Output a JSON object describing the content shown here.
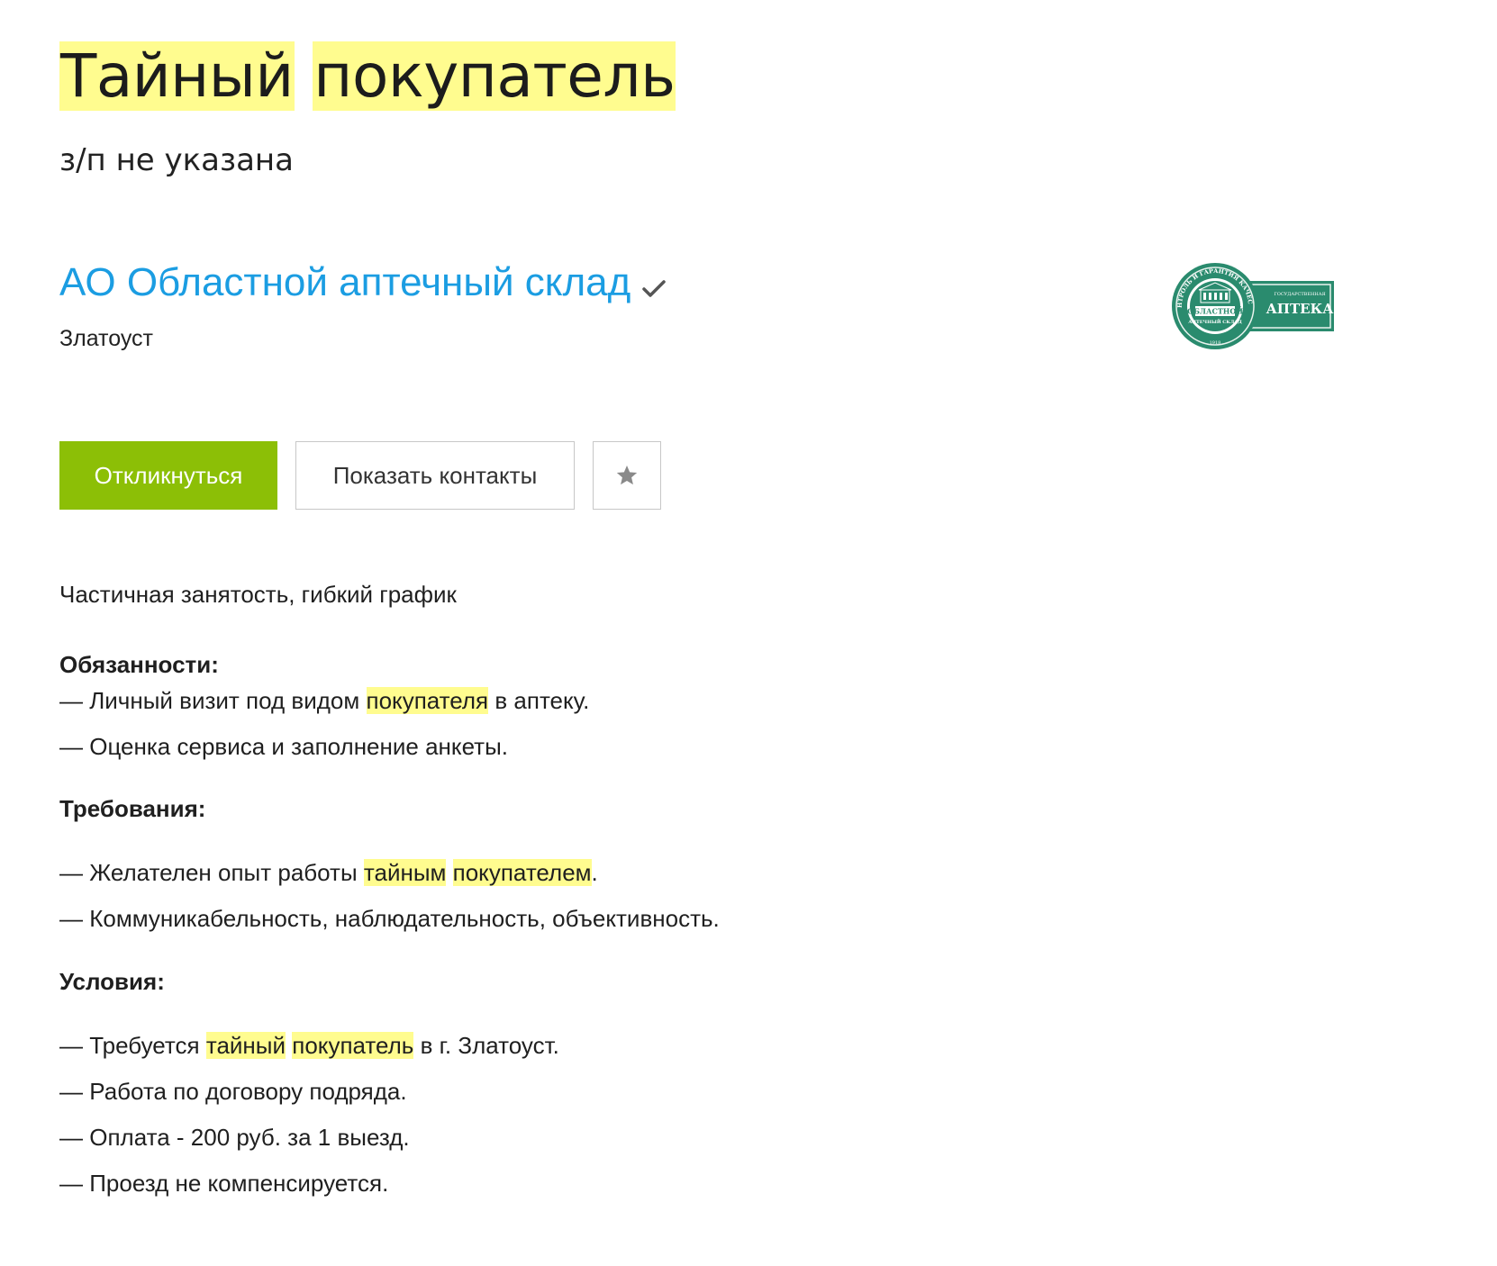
{
  "vacancy": {
    "title_word1": "Тайный",
    "title_word2": "покупатель",
    "salary": "з/п не указана"
  },
  "company": {
    "name": "АО Областной аптечный склад",
    "city": "Златоуст",
    "logo": {
      "ring_text_top": "КОНТРОЛЬ И ГАРАНТИЯ КАЧЕСТВА",
      "center_line1": "ОБЛАСТНОЙ",
      "center_line2": "АПТЕЧНЫЙ СКЛАД",
      "year": "1918",
      "right_small": "ГОСУДАРСТВЕННАЯ",
      "right_big": "АПТЕКА",
      "color": "#2a8b6e"
    }
  },
  "actions": {
    "respond_label": "Откликнуться",
    "contacts_label": "Показать контакты",
    "favorite_icon": "star-icon"
  },
  "description": {
    "employment": "Частичная занятость, гибкий график",
    "duties_heading": "Обязанности:",
    "duty1_pre": "— Личный визит под видом ",
    "duty1_hl": "покупателя",
    "duty1_post": " в аптеку.",
    "duty2": "— Оценка сервиса и заполнение анкеты.",
    "req_heading": "Требования:",
    "req1_pre": "— Желателен опыт работы ",
    "req1_hl1": "тайным",
    "req1_hl2": "покупателем",
    "req1_post": ".",
    "req2": "— Коммуникабельность, наблюдательность, объективность.",
    "cond_heading": "Условия:",
    "cond1_pre": "— Требуется ",
    "cond1_hl1": "тайный",
    "cond1_hl2": "покупатель",
    "cond1_post": " в г. Златоуст.",
    "cond2": "— Работа по договору подряда.",
    "cond3": "— Оплата - 200 руб. за 1 выезд.",
    "cond4": "— Проезд не компенсируется."
  },
  "colors": {
    "highlight": "#fffc8f",
    "link": "#1b9de2",
    "primary_button": "#8cbf06"
  }
}
